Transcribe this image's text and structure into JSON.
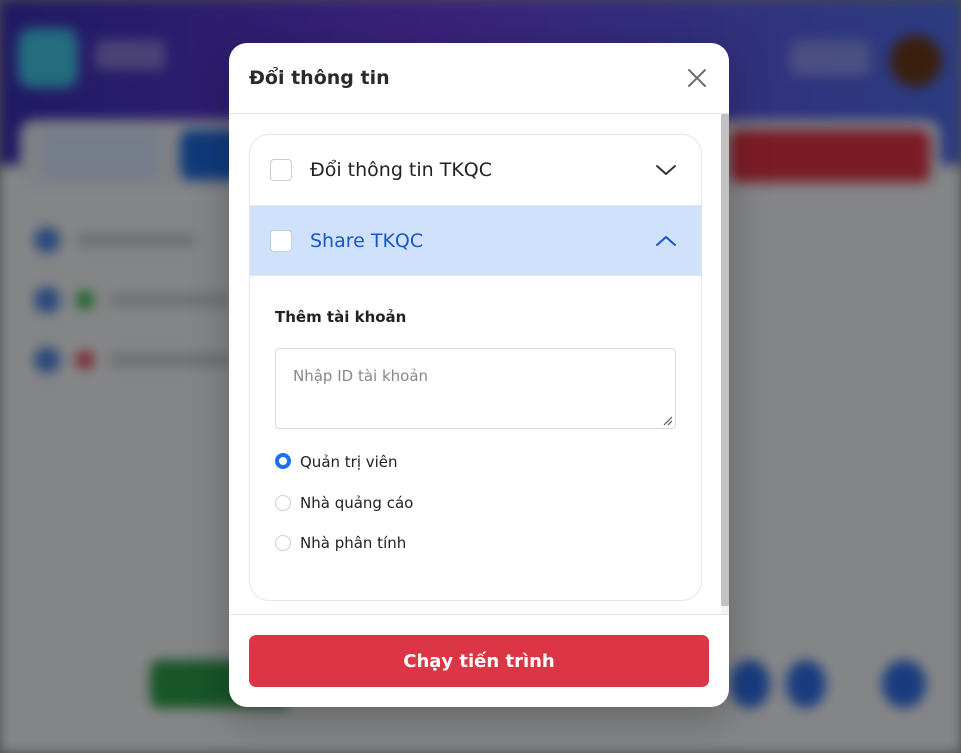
{
  "modal": {
    "title": "Đổi thông tin",
    "close_icon": "close-icon"
  },
  "accordion": {
    "sections": [
      {
        "label": "Đổi thông tin TKQC",
        "checked": false,
        "expanded": false,
        "icon": "chevron-down-icon"
      },
      {
        "label": "Share TKQC",
        "checked": false,
        "expanded": true,
        "icon": "chevron-up-icon"
      }
    ]
  },
  "share_form": {
    "field_label": "Thêm tài khoản",
    "account_input": {
      "value": "",
      "placeholder": "Nhập ID tài khoản"
    },
    "roles": [
      {
        "label": "Quản trị viên",
        "selected": true
      },
      {
        "label": "Nhà quảng cáo",
        "selected": false
      },
      {
        "label": "Nhà phân tính",
        "selected": false
      }
    ]
  },
  "footer": {
    "run_label": "Chạy tiến trình"
  },
  "colors": {
    "accent": "#1a56c7",
    "active_section_bg": "#d0e2fb",
    "radio_selected": "#1a6ef0",
    "run_button": "#dc3545"
  }
}
